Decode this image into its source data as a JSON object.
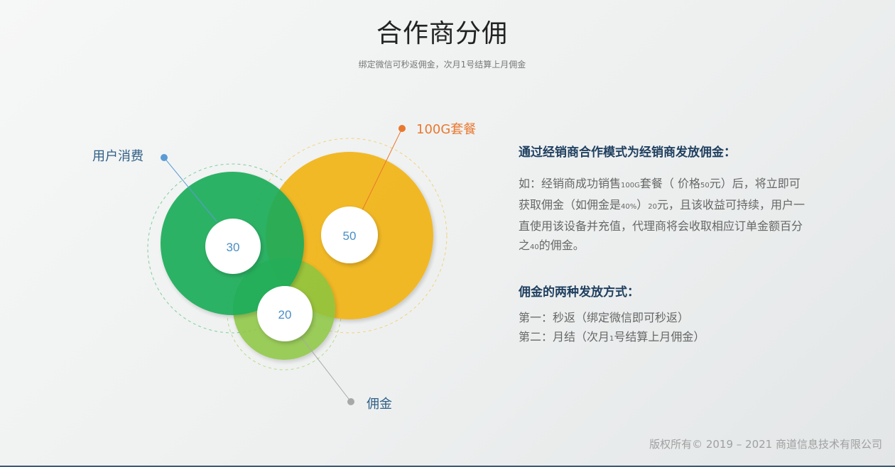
{
  "header": {
    "title": "合作商分佣",
    "subtitle": "绑定微信可秒返佣金，次月1号结算上月佣金"
  },
  "diagram": {
    "callouts": {
      "user_consumption": "用户消费",
      "package": "100G套餐",
      "commission": "佣金"
    },
    "values": {
      "green": "30",
      "yellow": "50",
      "lime": "20"
    },
    "colors": {
      "green": "#1fad5a",
      "yellow": "#f2b61a",
      "lime": "#8cc63f",
      "blue_accent": "#4a90d9",
      "orange_accent": "#e9782f",
      "gray_accent": "#a8a8a8"
    }
  },
  "info": {
    "heading1": "通过经销商合作模式为经销商发放佣金：",
    "p1_a": "如：经销商成功销售",
    "p1_b": "100G",
    "p1_c": "套餐（  价格",
    "p1_d": "50",
    "p1_e": "元）后，将立即可获取佣金（如佣金是",
    "p1_f": "40%",
    "p1_g": "）",
    "p1_h": "20",
    "p1_i": "元，且该收益可持续，用户一直使用该设备并充值，代理商将会收取相应订单金额百分之",
    "p1_j": "40",
    "p1_k": "的佣金。",
    "heading2": "佣金的两种发放方式：",
    "method1": "第一：秒返（绑定微信即可秒返）",
    "method2_a": "第二：月结（次月",
    "method2_b": "1",
    "method2_c": "号结算上月佣金）"
  },
  "footer": {
    "copyright": "版权所有© 2019 – 2021 商道信息技术有限公司"
  }
}
